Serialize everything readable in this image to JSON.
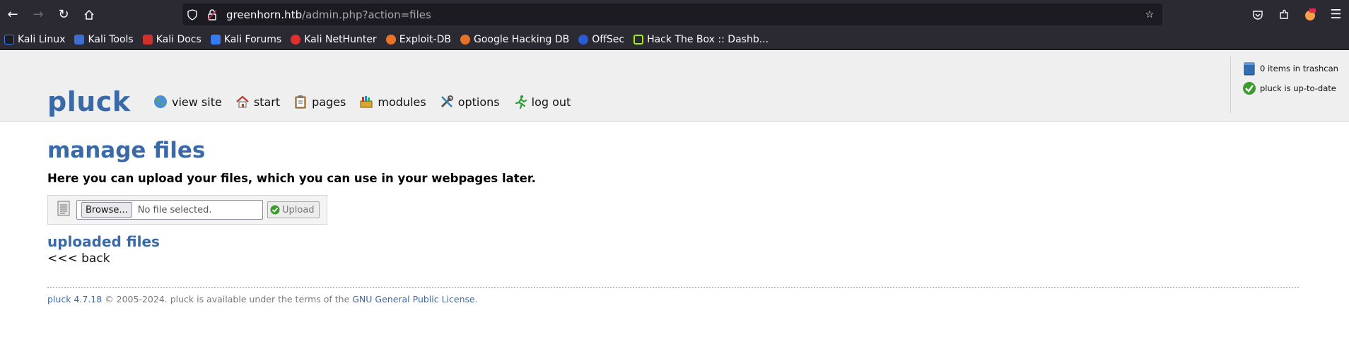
{
  "browser": {
    "url_host": "greenhorn.htb",
    "url_path": "/admin.php?action=files",
    "bookmarks": [
      {
        "label": "Kali Linux",
        "color": "#367bf0"
      },
      {
        "label": "Kali Tools",
        "color": "#3c6fd0"
      },
      {
        "label": "Kali Docs",
        "color": "#d0312d"
      },
      {
        "label": "Kali Forums",
        "color": "#367bf0"
      },
      {
        "label": "Kali NetHunter",
        "color": "#e03030"
      },
      {
        "label": "Exploit-DB",
        "color": "#e8722a"
      },
      {
        "label": "Google Hacking DB",
        "color": "#e8722a"
      },
      {
        "label": "OffSec",
        "color": "#2a5bd7"
      },
      {
        "label": "Hack The Box :: Dashb...",
        "color": "#9fef00"
      }
    ]
  },
  "header": {
    "logo": "pluck",
    "menu": {
      "view_site": "view site",
      "start": "start",
      "pages": "pages",
      "modules": "modules",
      "options": "options",
      "log_out": "log out"
    },
    "status": {
      "trashcan": "0 items in trashcan",
      "update": "pluck is up-to-date"
    }
  },
  "main": {
    "title": "manage files",
    "intro": "Here you can upload your files, which you can use in your webpages later.",
    "browse_label": "Browse...",
    "no_file": "No file selected.",
    "upload_label": "Upload",
    "uploaded_title": "uploaded files",
    "back": "<<< back"
  },
  "footer": {
    "version_link": "pluck 4.7.18",
    "text": " © 2005-2024. pluck is available under the terms of the ",
    "license_link": "GNU General Public License",
    "end": "."
  },
  "colors": {
    "accent": "#3a69a8",
    "chrome": "#2b2a33"
  }
}
